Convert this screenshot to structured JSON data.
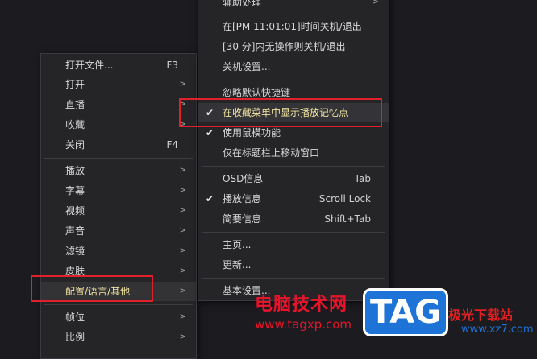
{
  "main_menu": {
    "items": [
      {
        "label": "打开文件...",
        "shortcut": "F3",
        "arrow": ""
      },
      {
        "label": "打开",
        "shortcut": "",
        "arrow": ">"
      },
      {
        "label": "直播",
        "shortcut": "",
        "arrow": ">"
      },
      {
        "label": "收藏",
        "shortcut": "",
        "arrow": ">"
      },
      {
        "label": "关闭",
        "shortcut": "F4",
        "arrow": ""
      },
      {
        "label": "播放",
        "shortcut": "",
        "arrow": ">"
      },
      {
        "label": "字幕",
        "shortcut": "",
        "arrow": ">"
      },
      {
        "label": "视频",
        "shortcut": "",
        "arrow": ">"
      },
      {
        "label": "声音",
        "shortcut": "",
        "arrow": ">"
      },
      {
        "label": "滤镜",
        "shortcut": "",
        "arrow": ">"
      },
      {
        "label": "皮肤",
        "shortcut": "",
        "arrow": ">"
      },
      {
        "label": "配置/语言/其他",
        "shortcut": "",
        "arrow": ">"
      },
      {
        "label": "帧位",
        "shortcut": "",
        "arrow": ">"
      },
      {
        "label": "比例",
        "shortcut": "",
        "arrow": ">"
      }
    ]
  },
  "sub_menu": {
    "items": [
      {
        "label": "辅助处理",
        "shortcut": "",
        "arrow": ">",
        "check": ""
      },
      {
        "label": "在[PM 11:01:01]时间关机/退出",
        "shortcut": "",
        "arrow": "",
        "check": ""
      },
      {
        "label": "[30 分]内无操作则关机/退出",
        "shortcut": "",
        "arrow": "",
        "check": ""
      },
      {
        "label": "关机设置...",
        "shortcut": "",
        "arrow": "",
        "check": ""
      },
      {
        "label": "忽略默认快捷键",
        "shortcut": "",
        "arrow": "",
        "check": ""
      },
      {
        "label": "在收藏菜单中显示播放记忆点",
        "shortcut": "",
        "arrow": "",
        "check": "✔"
      },
      {
        "label": "使用鼠模功能",
        "shortcut": "",
        "arrow": "",
        "check": "✔"
      },
      {
        "label": "仅在标题栏上移动窗口",
        "shortcut": "",
        "arrow": "",
        "check": ""
      },
      {
        "label": "OSD信息",
        "shortcut": "Tab",
        "arrow": "",
        "check": ""
      },
      {
        "label": "播放信息",
        "shortcut": "Scroll Lock",
        "arrow": "",
        "check": "✔"
      },
      {
        "label": "简要信息",
        "shortcut": "Shift+Tab",
        "arrow": "",
        "check": ""
      },
      {
        "label": "主页...",
        "shortcut": "",
        "arrow": "",
        "check": ""
      },
      {
        "label": "更新...",
        "shortcut": "",
        "arrow": "",
        "check": ""
      },
      {
        "label": "基本设置...",
        "shortcut": "",
        "arrow": "",
        "check": ""
      }
    ]
  },
  "watermark": {
    "site_name": "电脑技术网",
    "url": "www.tagxp.com",
    "tag": "TAG",
    "jg": "极光下载站",
    "xz": "www.xz7.com"
  }
}
